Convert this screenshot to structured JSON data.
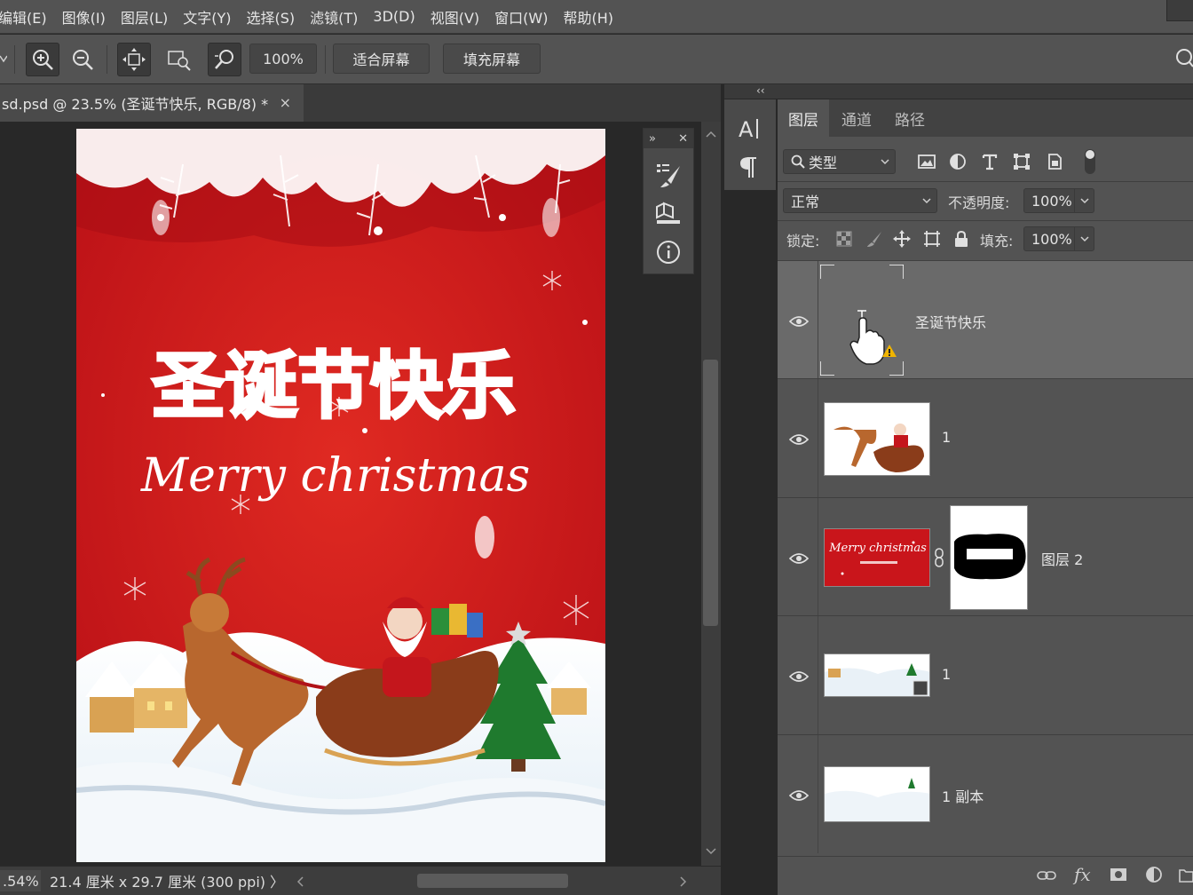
{
  "menu": [
    "编辑(E)",
    "图像(I)",
    "图层(L)",
    "文字(Y)",
    "选择(S)",
    "滤镜(T)",
    "3D(D)",
    "视图(V)",
    "窗口(W)",
    "帮助(H)"
  ],
  "options_bar": {
    "zoom_value": "100%",
    "fit_screen_label": "适合屏幕",
    "fill_screen_label": "填充屏幕"
  },
  "document": {
    "tab_title": "sd.psd @ 23.5% (圣诞节快乐, RGB/8) *",
    "close_glyph": "×",
    "poster_title": "圣诞节快乐",
    "poster_subtitle": "Merry christmas"
  },
  "status_bar": {
    "zoom": ".54%",
    "dimensions": "21.4 厘米 x 29.7 厘米 (300 ppi)",
    "arrow": "〉"
  },
  "layers_panel": {
    "tabs": [
      "图层",
      "通道",
      "路径"
    ],
    "filter_kind": "类型",
    "blend_mode": "正常",
    "opacity_label": "不透明度:",
    "opacity_value": "100%",
    "lock_label": "锁定:",
    "fill_label": "填充:",
    "fill_value": "100%",
    "layers": [
      {
        "name": "圣诞节快乐",
        "type": "smart-text",
        "selected": true
      },
      {
        "name": "1",
        "type": "image"
      },
      {
        "name": "图层 2",
        "type": "image-with-mask"
      },
      {
        "name": "1",
        "type": "smart-object"
      },
      {
        "name": "1 副本",
        "type": "image"
      }
    ],
    "footer_fx": "fx"
  },
  "colors": {
    "ui_bg": "#535353",
    "ui_dark": "#282828",
    "poster_red": "#c9151b",
    "selected_layer": "#6a6a6a"
  }
}
